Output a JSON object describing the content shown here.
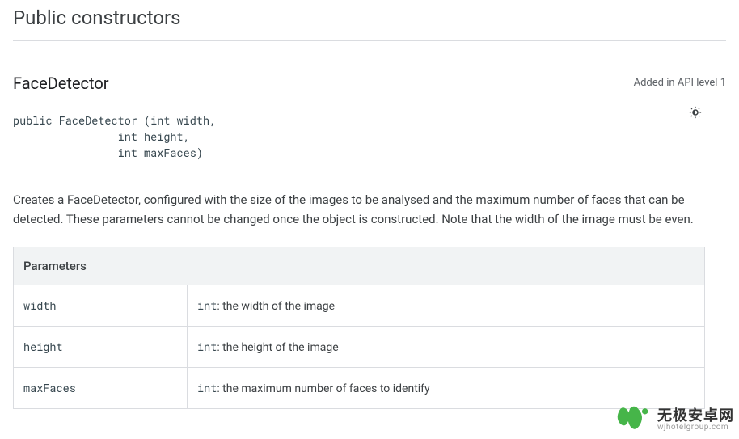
{
  "section_title": "Public constructors",
  "method": {
    "name": "FaceDetector",
    "api_level": "Added in API level 1",
    "signature": "public FaceDetector (int width, \n                int height, \n                int maxFaces)",
    "description": "Creates a FaceDetector, configured with the size of the images to be analysed and the maximum number of faces that can be detected. These parameters cannot be changed once the object is constructed. Note that the width of the image must be even."
  },
  "params_table": {
    "header": "Parameters",
    "rows": [
      {
        "name": "width",
        "type": "int",
        "desc": ": the width of the image"
      },
      {
        "name": "height",
        "type": "int",
        "desc": ": the height of the image"
      },
      {
        "name": "maxFaces",
        "type": "int",
        "desc": ": the maximum number of faces to identify"
      }
    ]
  },
  "watermark": {
    "line1": "无极安卓网",
    "line2": "wjhotelgroup.com"
  }
}
